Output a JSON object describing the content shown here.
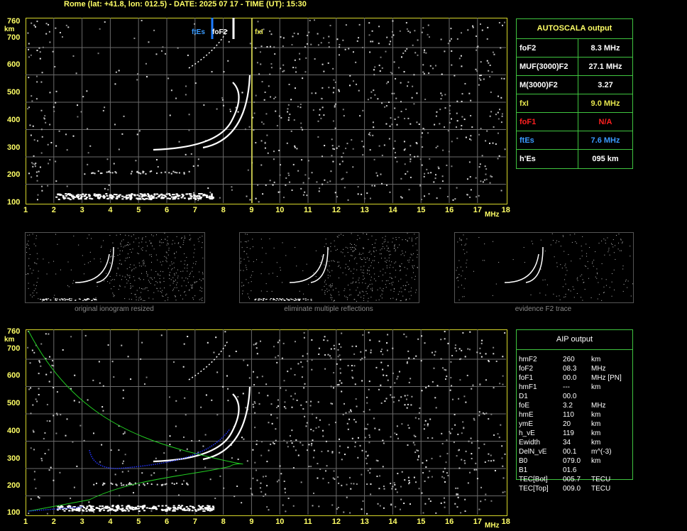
{
  "header": {
    "title": "Rome (lat: +41.8, lon: 012.5) - DATE: 2025 07 17 - TIME (UT): 15:30"
  },
  "axes": {
    "y_ticks": [
      "100",
      "200",
      "300",
      "400",
      "500",
      "600",
      "700"
    ],
    "y_top": "760",
    "y_unit": "km",
    "x_ticks": [
      "1",
      "2",
      "3",
      "4",
      "5",
      "6",
      "7",
      "8",
      "9",
      "10",
      "11",
      "12",
      "13",
      "14",
      "15",
      "16",
      "17",
      "18"
    ],
    "x_unit": "MHz"
  },
  "markers": {
    "ftEs": "ftEs",
    "foF2": "foF2",
    "fxI": "fxI"
  },
  "autoscala": {
    "title": "AUTOSCALA output",
    "rows": [
      {
        "label": "foF2",
        "value": "8.3 MHz",
        "color": "#ffffff"
      },
      {
        "label": "MUF(3000)F2",
        "value": "27.1 MHz",
        "color": "#ffffff"
      },
      {
        "label": "M(3000)F2",
        "value": "3.27",
        "color": "#ffffff"
      },
      {
        "label": "fxI",
        "value": "9.0 MHz",
        "color": "#e6e64d"
      },
      {
        "label": "foF1",
        "value": "N/A",
        "color": "#ff2020"
      },
      {
        "label": "ftEs",
        "value": "7.6 MHz",
        "color": "#3a9bff"
      },
      {
        "label": "h'Es",
        "value": "095      km",
        "color": "#ffffff"
      }
    ]
  },
  "thumbs": [
    {
      "caption": "original ionogram resized"
    },
    {
      "caption": "eliminate multiple reflections"
    },
    {
      "caption": "evidence F2 trace"
    }
  ],
  "aip": {
    "title": "AIP output",
    "rows": [
      {
        "name": "hmF2",
        "value": "260",
        "unit": "km"
      },
      {
        "name": "foF2",
        "value": "08.3",
        "unit": "MHz"
      },
      {
        "name": "foF1",
        "value": "00.0",
        "unit": "MHz    [PN]"
      },
      {
        "name": "hmF1",
        "value": "---",
        "unit": "km"
      },
      {
        "name": "D1",
        "value": "00.0",
        "unit": ""
      },
      {
        "name": "foE",
        "value": "3.2",
        "unit": "MHz"
      },
      {
        "name": "hmE",
        "value": "110",
        "unit": "km"
      },
      {
        "name": "ymE",
        "value": "20",
        "unit": "km"
      },
      {
        "name": "h_vE",
        "value": "119",
        "unit": "km"
      },
      {
        "name": "Ewidth",
        "value": "34",
        "unit": "km"
      },
      {
        "name": "DelN_vE",
        "value": "00.1",
        "unit": "m^(-3)"
      },
      {
        "name": "B0",
        "value": "079.0",
        "unit": "km"
      },
      {
        "name": "B1",
        "value": "01.6",
        "unit": ""
      },
      {
        "name": "TEC[Bot]",
        "value": "005.7",
        "unit": "TECU"
      },
      {
        "name": "TEC[Top]",
        "value": "009.0",
        "unit": "TECU"
      }
    ]
  },
  "colors": {
    "axis": "#d6d62a",
    "grid": "#6a6a6a",
    "trace": "#ffffff",
    "profile": "#22cc22",
    "fit": "#2233ff",
    "ftEs": "#1e7dff",
    "fxI": "#e6e64d"
  }
}
